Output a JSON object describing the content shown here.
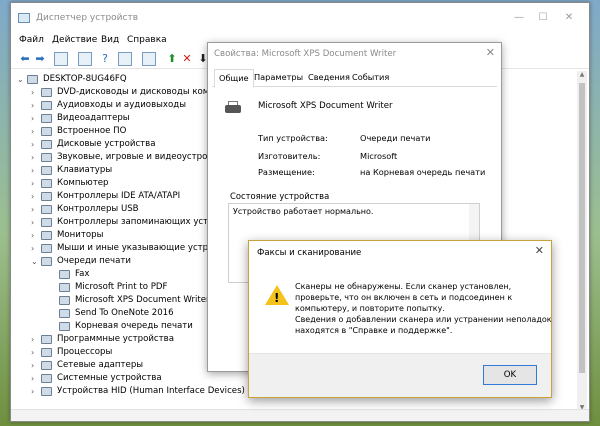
{
  "window": {
    "title": "Диспетчер устройств"
  },
  "menu": [
    "Файл",
    "Действие",
    "Вид",
    "Справка"
  ],
  "tree": {
    "root": "DESKTOP-8UG46FQ",
    "items": [
      "DVD-дисководы и дисководы компакт-дисков",
      "Аудиовходы и аудиовыходы",
      "Видеоадаптеры",
      "Встроенное ПО",
      "Дисковые устройства",
      "Звуковые, игровые и видеоустройства",
      "Клавиатуры",
      "Компьютер",
      "Контроллеры IDE ATA/ATAPI",
      "Контроллеры USB",
      "Контроллеры запоминающих устройств",
      "Мониторы",
      "Мыши и иные указывающие устройства",
      "Очереди печати",
      "Fax",
      "Microsoft Print to PDF",
      "Microsoft XPS Document Writer",
      "Send To OneNote 2016",
      "Корневая очередь печати",
      "Программные устройства",
      "Процессоры",
      "Сетевые адаптеры",
      "Системные устройства",
      "Устройства HID (Human Interface Devices)"
    ]
  },
  "props": {
    "title": "Свойства: Microsoft XPS Document Writer",
    "tabs": [
      "Общие",
      "Параметры",
      "Сведения",
      "События"
    ],
    "device_name": "Microsoft XPS Document Writer",
    "labels": {
      "type": "Тип устройства:",
      "maker": "Изготовитель:",
      "location": "Размещение:"
    },
    "values": {
      "type": "Очереди печати",
      "maker": "Microsoft",
      "location": "на Корневая очередь печати"
    },
    "status_group": "Состояние устройства",
    "status_text": "Устройство работает нормально."
  },
  "fax": {
    "title": "Факсы и сканирование",
    "lines": [
      "Сканеры не обнаружены. Если сканер установлен,",
      "проверьте, что он включен в сеть и подсоединен к",
      "компьютеру, и повторите попытку.",
      "Сведения о добавлении сканера или устранении неполадок",
      "находятся в \"Справке и поддержке\"."
    ],
    "ok": "OK"
  }
}
